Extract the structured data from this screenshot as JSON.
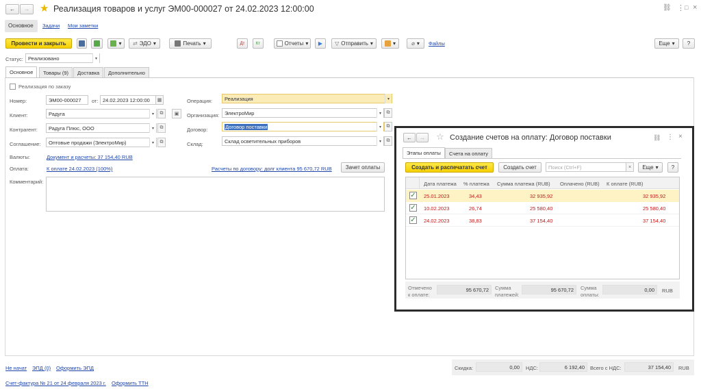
{
  "window": {
    "title": "Реализация товаров и услуг ЭМ00-000027 от 24.02.2023 12:00:00"
  },
  "nav_tabs": [
    "Основное",
    "Задачи",
    "Мои заметки"
  ],
  "toolbar": {
    "post_close": "Провести и закрыть",
    "edo": "ЭДО",
    "print": "Печать",
    "reports": "Отчеты",
    "send": "Отправить",
    "files": "Файлы",
    "more": "Еще"
  },
  "status": {
    "label": "Статус:",
    "value": "Реализовано"
  },
  "form_tabs": [
    "Основное",
    "Товары (9)",
    "Доставка",
    "Дополнительно"
  ],
  "form": {
    "by_order": "Реализация по заказу",
    "number_label": "Номер:",
    "number": "ЭМ00-000027",
    "from_label": "от:",
    "date": "24.02.2023 12:00:00",
    "client_label": "Клиент:",
    "client": "Радуга",
    "counterparty_label": "Контрагент:",
    "counterparty": "Радуга Плюс, ООО",
    "agreement_label": "Соглашение:",
    "agreement": "Оптовые продажи (ЭлектроМир)",
    "currency_label": "Валюты:",
    "currency_link": "Документ и расчеты: 37 154,40 RUB",
    "payment_label": "Оплата:",
    "payment_link": "К оплате 24.02.2023 (100%)",
    "settlements_link": "Расчеты по договору: долг клиента 95 670,72 RUB",
    "offset_btn": "Зачет оплаты",
    "comment_label": "Комментарий:",
    "operation_label": "Операция:",
    "operation": "Реализация",
    "org_label": "Организация:",
    "org": "ЭлектроМир",
    "contract_label": "Договор:",
    "contract": "Договор поставки",
    "warehouse_label": "Склад:",
    "warehouse": "Склад осветительных приборов"
  },
  "footer": {
    "links1": [
      "Не начат",
      "ЭПД (0)",
      "Оформить ЭПД"
    ],
    "links2": [
      "Счет-фактура № 21 от 24 февраля 2023 г.",
      "Оформить ТТН"
    ],
    "discount_label": "Скидка:",
    "discount": "0,00",
    "vat_label": "НДС:",
    "vat": "6 192,40",
    "total_label": "Всего с НДС:",
    "total": "37 154,40",
    "currency": "RUB"
  },
  "dialog": {
    "title": "Создание счетов на оплату: Договор поставки",
    "tabs": [
      "Этапы оплаты",
      "Счета на оплату"
    ],
    "create_print": "Создать и распечатать счет",
    "create": "Создать счет",
    "search_placeholder": "Поиск (Ctrl+F)",
    "more": "Еще",
    "help": "?",
    "columns": [
      "Дата платежа",
      "% платежа",
      "Сумма платежа (RUB)",
      "Оплачено (RUB)",
      "К оплате (RUB)"
    ],
    "rows": [
      {
        "date": "25.01.2023",
        "pct": "34,43",
        "sum": "32 935,92",
        "paid": "",
        "due": "32 935,92",
        "checked": true
      },
      {
        "date": "10.02.2023",
        "pct": "26,74",
        "sum": "25 580,40",
        "paid": "",
        "due": "25 580,40",
        "checked": true
      },
      {
        "date": "24.02.2023",
        "pct": "38,83",
        "sum": "37 154,40",
        "paid": "",
        "due": "37 154,40",
        "checked": true
      }
    ],
    "marked_label_1": "Отмечено",
    "marked_label_2": "к оплате:",
    "marked": "95 670,72",
    "payments_label_1": "Сумма",
    "payments_label_2": "платежей:",
    "payments": "95 670,72",
    "payment_label_1": "Сумма",
    "payment_label_2": "оплаты:",
    "payment": "0,00",
    "currency": "RUB"
  },
  "colors": {
    "accent": "#f5cf00",
    "link": "#2047a9",
    "row_red": "#c0191a",
    "highlight": "#fdf3c4"
  }
}
